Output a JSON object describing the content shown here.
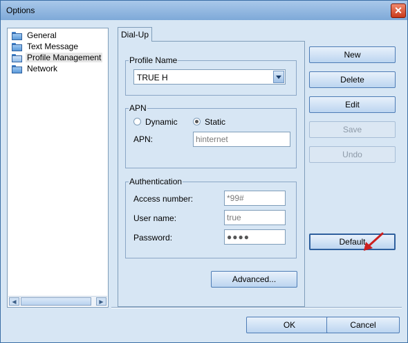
{
  "window": {
    "title": "Options",
    "close_glyph": "✕"
  },
  "tree": {
    "items": [
      {
        "label": "General",
        "icon": "folder-icon",
        "selected": false
      },
      {
        "label": "Text Message",
        "icon": "folder-icon",
        "selected": false
      },
      {
        "label": "Profile Management",
        "icon": "folder-open-icon",
        "selected": true
      },
      {
        "label": "Network",
        "icon": "folder-icon",
        "selected": false
      }
    ],
    "scroll_left": "◀",
    "scroll_right": "▶"
  },
  "tab": {
    "label": "Dial-Up"
  },
  "profile": {
    "group_title": "Profile Name",
    "selected_value": "TRUE H"
  },
  "apn": {
    "group_title": "APN",
    "option_dynamic": "Dynamic",
    "option_static": "Static",
    "selected": "Static",
    "apn_label": "APN:",
    "apn_value": "hinternet"
  },
  "auth": {
    "group_title": "Authentication",
    "access_label": "Access number:",
    "access_value": "*99#",
    "user_label": "User name:",
    "user_value": "true",
    "password_label": "Password:",
    "password_value": "●●●●"
  },
  "buttons": {
    "advanced": "Advanced...",
    "new": "New",
    "delete": "Delete",
    "edit": "Edit",
    "save": "Save",
    "undo": "Undo",
    "default": "Default",
    "ok": "OK",
    "cancel": "Cancel"
  },
  "colors": {
    "background": "#d7e6f4",
    "pointer_arrow": "#cc1f1f"
  }
}
